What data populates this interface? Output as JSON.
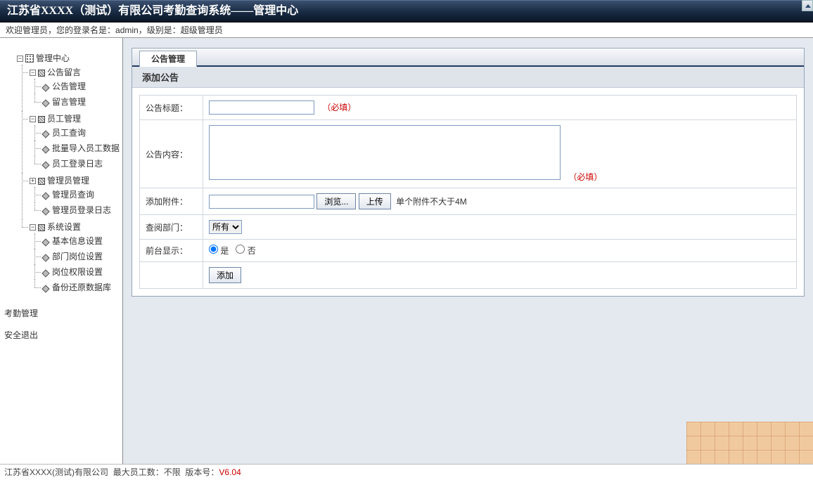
{
  "header": {
    "title": "江苏省XXXX（测试）有限公司考勤查询系统——管理中心"
  },
  "subheader": {
    "text_prefix": "欢迎管理员，您的登录名是：",
    "login": "admin",
    "text_mid": "，级别是：",
    "role": "超级管理员"
  },
  "sidebar": {
    "root": "管理中心",
    "groups": [
      {
        "label": "公告留言",
        "expanded": true,
        "children": [
          "公告管理",
          "留言管理"
        ]
      },
      {
        "label": "员工管理",
        "expanded": true,
        "children": [
          "员工查询",
          "批量导入员工数据",
          "员工登录日志"
        ]
      },
      {
        "label": "管理员管理",
        "expanded": true,
        "children": [
          "管理员查询",
          "管理员登录日志"
        ]
      },
      {
        "label": "系统设置",
        "expanded": true,
        "children": [
          "基本信息设置",
          "部门岗位设置",
          "岗位权限设置",
          "备份还原数据库"
        ]
      }
    ],
    "flat": [
      "考勤管理",
      "安全退出"
    ]
  },
  "main": {
    "tab": "公告管理",
    "section": "添加公告",
    "form": {
      "title_label": "公告标题：",
      "content_label": "公告内容：",
      "attach_label": "添加附件：",
      "browse_btn": "浏览...",
      "upload_btn": "上传",
      "attach_hint": "单个附件不大于4M",
      "dept_label": "查阅部门：",
      "dept_value": "所有",
      "show_label": "前台显示：",
      "radio_yes": "是",
      "radio_no": "否",
      "submit": "添加",
      "required": "（必填）"
    }
  },
  "footer": {
    "company": "江苏省XXXX(测试)有限公司",
    "max_label": "最大员工数：",
    "max_value": "不限",
    "ver_label": "版本号：",
    "ver_value": "V6.04"
  }
}
